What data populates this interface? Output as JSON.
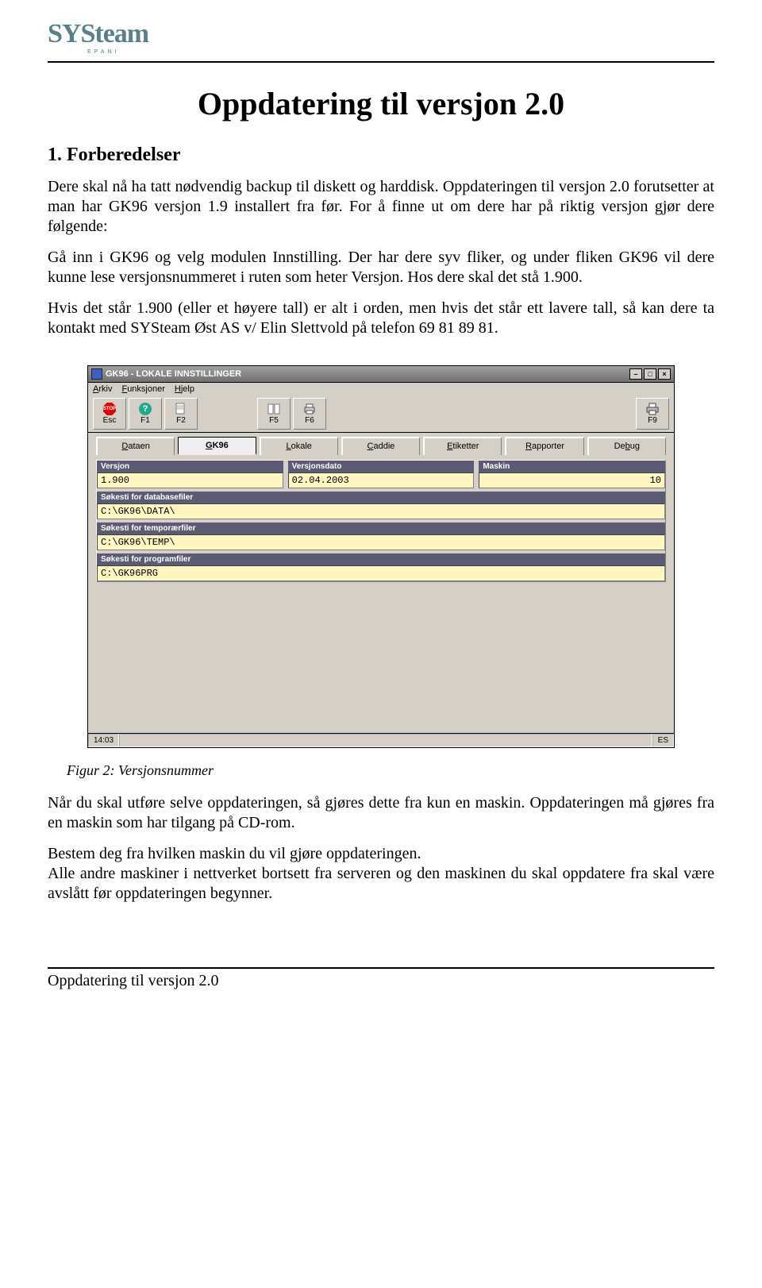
{
  "logo": {
    "main": "SYSteam",
    "sub": "EPANI"
  },
  "title": "Oppdatering til versjon 2.0",
  "h2": "1. Forberedelser",
  "p1": "Dere skal nå ha tatt nødvendig backup til diskett og harddisk. Oppdateringen til versjon 2.0 forutsetter at man har GK96 versjon 1.9 installert fra før. For å finne ut om dere har på riktig versjon gjør dere følgende:",
  "p2": "Gå inn i GK96 og velg modulen Innstilling. Der har dere syv fliker, og under fliken GK96 vil dere kunne lese versjonsnummeret i ruten som heter Versjon. Hos dere skal det stå 1.900.",
  "p3": "Hvis det står 1.900 (eller et høyere tall) er alt i orden, men hvis det står ett lavere tall, så kan dere ta kontakt med SYSteam Øst AS v/ Elin Slettvold på telefon 69 81 89 81.",
  "caption": "Figur 2: Versjonsnummer",
  "p4": "Når du skal utføre selve oppdateringen, så gjøres dette fra kun en maskin. Oppdateringen må gjøres fra en maskin som har tilgang på CD-rom.",
  "p5": "Bestem deg fra hvilken maskin du vil gjøre oppdateringen.",
  "p6": "Alle andre maskiner i nettverket bortsett fra serveren og den maskinen du skal oppdatere fra skal være avslått før oppdateringen begynner.",
  "footer": "Oppdatering til versjon 2.0",
  "app": {
    "title": "GK96 - LOKALE INNSTILLINGER",
    "menu": {
      "arkiv": "Arkiv",
      "funksjoner": "Funksjoner",
      "hjelp": "Hjelp"
    },
    "toolbar": {
      "esc": "Esc",
      "f1": "F1",
      "f2": "F2",
      "f5": "F5",
      "f6": "F6",
      "f9": "F9",
      "stop_text": "STOP"
    },
    "tabs": {
      "dataen": "Dataen",
      "gk96": "GK96",
      "lokale": "Lokale",
      "caddie": "Caddie",
      "etiketter": "Etiketter",
      "rapporter": "Rapporter",
      "debug": "Debug"
    },
    "fields": {
      "versjon_label": "Versjon",
      "versjon_value": "1.900",
      "versjonsdato_label": "Versjonsdato",
      "versjonsdato_value": "02.04.2003",
      "maskin_label": "Maskin",
      "maskin_value": "10",
      "db_label": "Søkesti for databasefiler",
      "db_value": "C:\\GK96\\DATA\\",
      "temp_label": "Søkesti for temporærfiler",
      "temp_value": "C:\\GK96\\TEMP\\",
      "prg_label": "Søkesti for programfiler",
      "prg_value": "C:\\GK96PRG"
    },
    "status": {
      "time": "14:03",
      "lang": "ES"
    }
  }
}
